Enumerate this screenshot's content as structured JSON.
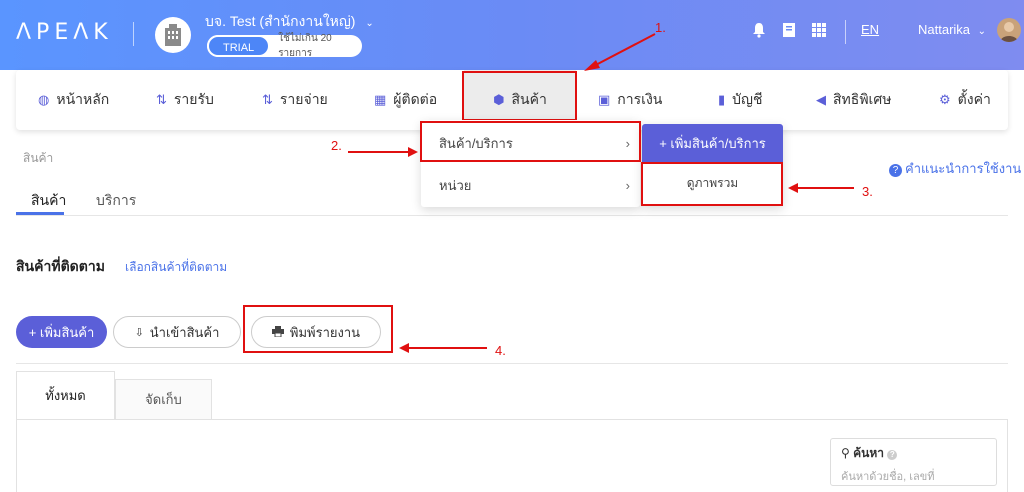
{
  "header": {
    "logo": "ΛPEΛK",
    "company": "บจ. Test (สำนักงานใหญ่)",
    "trial_label": "TRIAL",
    "trial_limit": "ใช้ไม่เกิน 20 รายการ",
    "lang": "EN",
    "user": "Nattarika",
    "icons": [
      "bell-icon",
      "book-icon",
      "grid-icon"
    ]
  },
  "nav": {
    "items": [
      {
        "label": "หน้าหลัก",
        "icon": "dashboard-icon"
      },
      {
        "label": "รายรับ",
        "icon": "income-icon"
      },
      {
        "label": "รายจ่าย",
        "icon": "expense-icon"
      },
      {
        "label": "ผู้ติดต่อ",
        "icon": "contacts-icon"
      },
      {
        "label": "สินค้า",
        "icon": "box-icon"
      },
      {
        "label": "การเงิน",
        "icon": "money-icon"
      },
      {
        "label": "บัญชี",
        "icon": "ledger-icon"
      },
      {
        "label": "สิทธิพิเศษ",
        "icon": "megaphone-icon"
      },
      {
        "label": "ตั้งค่า",
        "icon": "gear-icon"
      }
    ]
  },
  "dropdown": {
    "items": [
      {
        "label": "สินค้า/บริการ"
      },
      {
        "label": "หน่วย"
      }
    ],
    "submenu": {
      "add_label": "+ เพิ่มสินค้า/บริการ",
      "overview_label": "ดูภาพรวม"
    }
  },
  "annotations": [
    "1.",
    "2.",
    "3.",
    "4."
  ],
  "page": {
    "breadcrumb": "สินค้า",
    "help": "คำแนะนำการใช้งาน",
    "tabs": [
      "สินค้า",
      "บริการ"
    ],
    "section_title": "สินค้าที่ติดตาม",
    "section_link": "เลือกสินค้าที่ติดตาม",
    "buttons": {
      "add": "+ เพิ่มสินค้า",
      "import": "นำเข้าสินค้า",
      "print": "พิมพ์รายงาน"
    },
    "box_tabs": [
      "ทั้งหมด",
      "จัดเก็บ"
    ],
    "search": {
      "label": "ค้นหา",
      "placeholder": "ค้นหาด้วยชื่อ, เลขที่"
    }
  },
  "colors": {
    "primary": "#5b5fd8",
    "link": "#4a72e8",
    "annotation": "#e01010"
  }
}
